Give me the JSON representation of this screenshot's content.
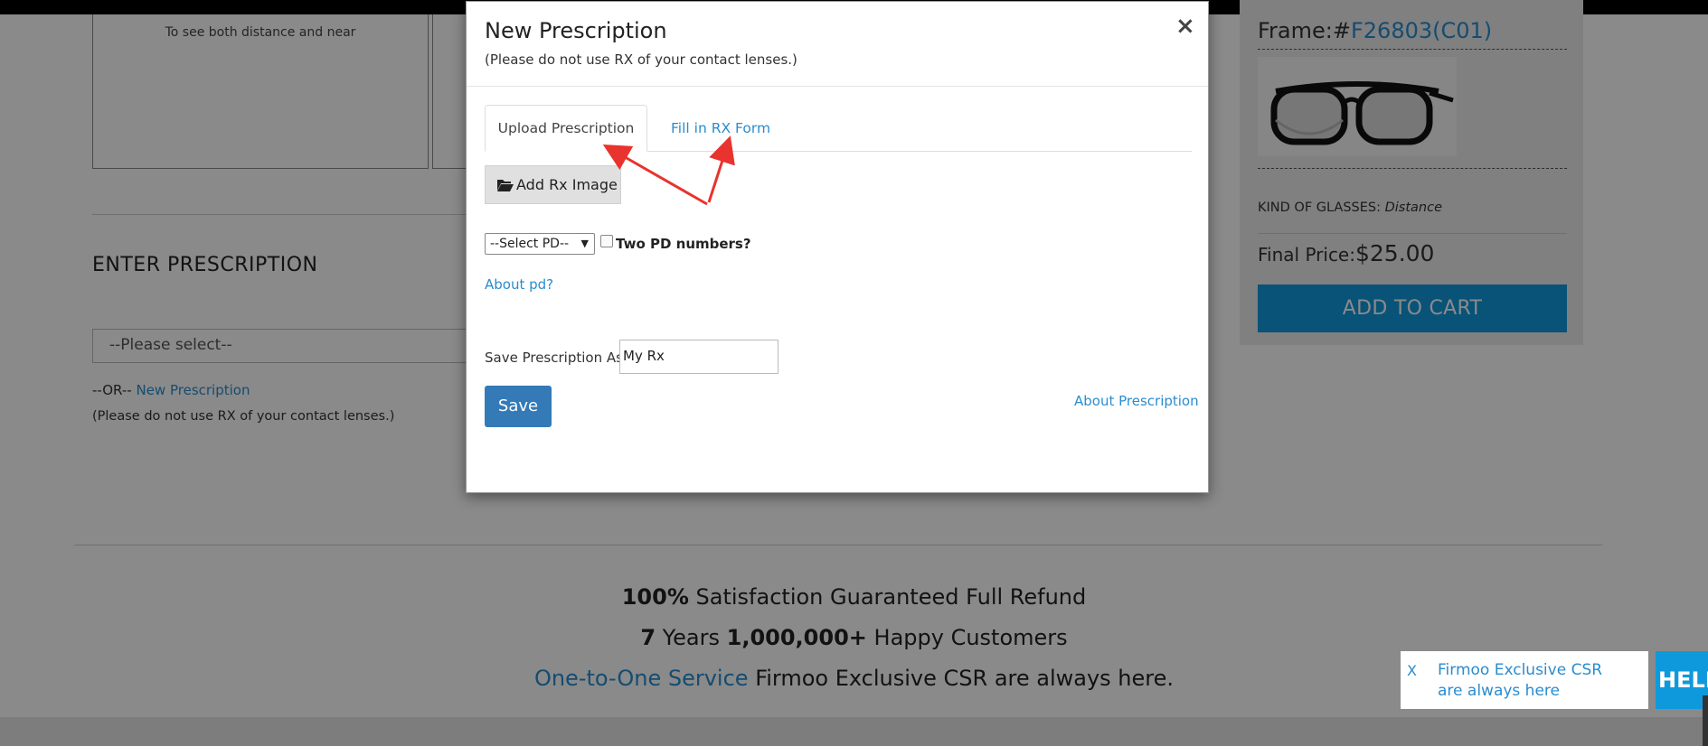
{
  "background": {
    "lens_box_caption": "To see both distance and near",
    "enter_prescription_title": "ENTER PRESCRIPTION",
    "select_placeholder": "--Please select--",
    "or_prefix": "--OR--",
    "new_prescription_link": "New Prescription",
    "contact_lens_note": "(Please do not use RX of your contact lenses.)"
  },
  "product_panel": {
    "frame_label": "Frame:#",
    "frame_code": "F26803(C01)",
    "kind_label": "KIND OF GLASSES:",
    "kind_value": "Distance",
    "final_price_label": "Final Price:",
    "final_price_value": "$25.00",
    "add_to_cart_label": "ADD TO CART"
  },
  "footer": {
    "line1_bold": "100%",
    "line1_rest": "Satisfaction Guaranteed Full Refund",
    "line2_years_num": "7",
    "line2_years": "Years",
    "line2_customers_num": "1,000,000+",
    "line2_rest": "Happy Customers",
    "line3_link": "One-to-One Service",
    "line3_rest": "Firmoo Exclusive CSR are always here."
  },
  "chat_widget": {
    "close_label": "X",
    "message": "Firmoo Exclusive CSR are always here",
    "help_label": "HELP"
  },
  "modal": {
    "title": "New Prescription",
    "subtitle": "(Please do not use RX of your contact lenses.)",
    "close_symbol": "×",
    "tabs": [
      {
        "label": "Upload Prescription",
        "active": true
      },
      {
        "label": "Fill in RX Form",
        "active": false
      }
    ],
    "add_rx_image_label": "Add Rx Image",
    "pd_select_value": "--Select PD--",
    "pd_select_arrow": "▼",
    "two_pd_label": "Two PD numbers?",
    "two_pd_checked": false,
    "about_pd_link": "About pd?",
    "save_as_label": "Save Prescription As:",
    "save_as_value": "My Rx",
    "save_button_label": "Save",
    "about_prescription_link": "About Prescription"
  },
  "colors": {
    "link": "#2a8ccf",
    "cart_button": "#0f99dd",
    "save_button": "#337ab7",
    "annotation_arrow": "#e8332e"
  }
}
